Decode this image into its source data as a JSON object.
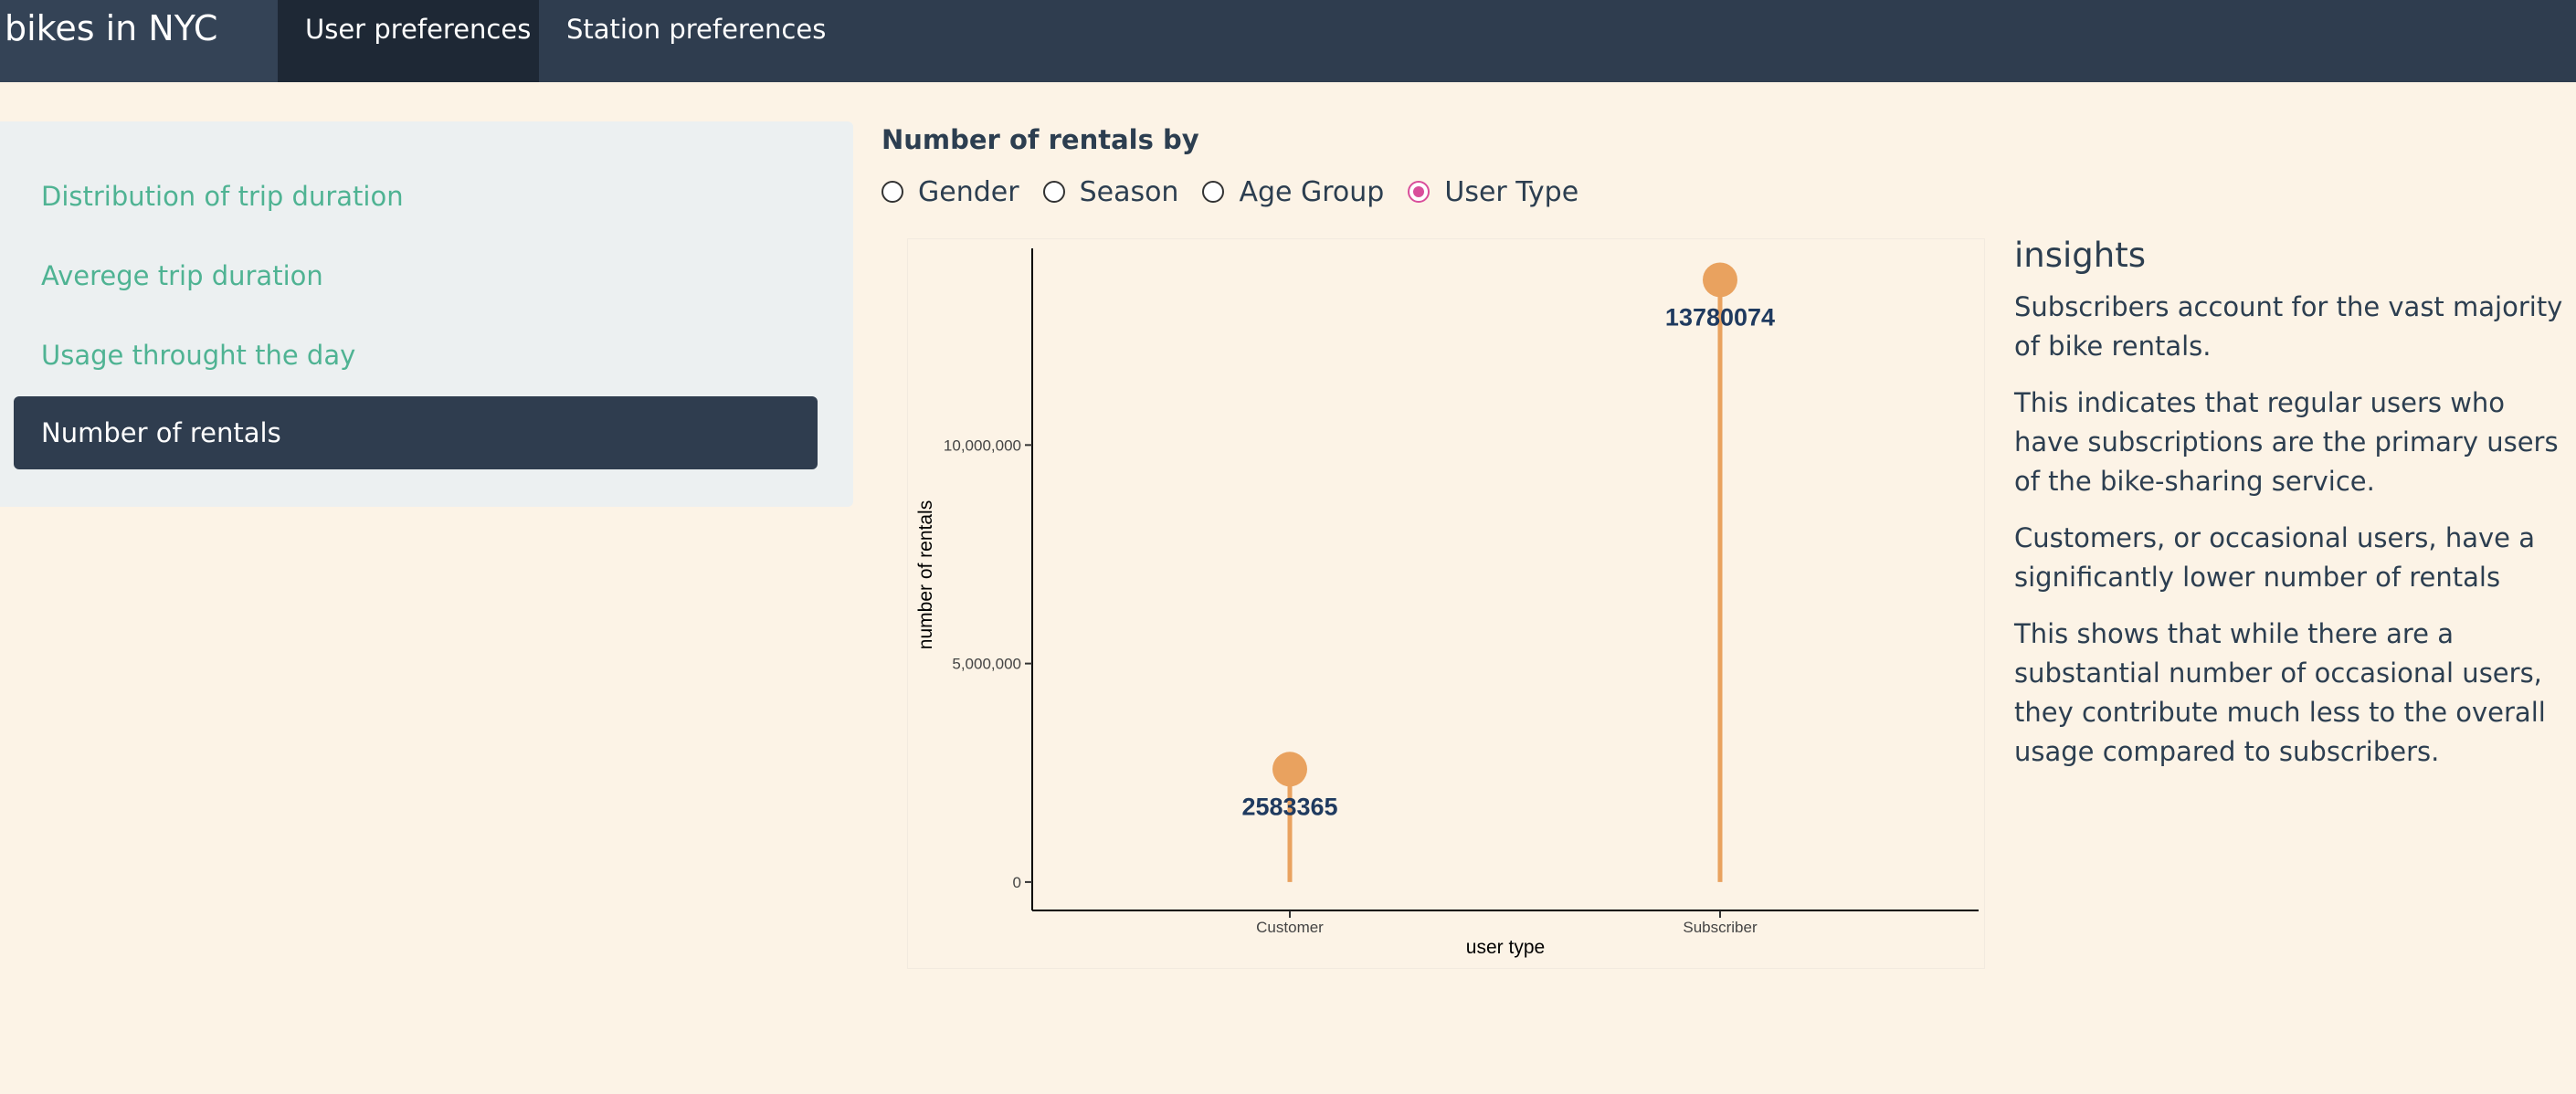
{
  "app": {
    "brand": "bikes in NYC",
    "tabs": [
      {
        "label": "User preferences",
        "active": true
      },
      {
        "label": "Station preferences",
        "active": false
      }
    ]
  },
  "sidebar": {
    "items": [
      {
        "label": "Distribution of trip duration",
        "active": false
      },
      {
        "label": "Averege trip duration",
        "active": false
      },
      {
        "label": "Usage throught the day",
        "active": false
      },
      {
        "label": "Number of rentals",
        "active": true
      }
    ]
  },
  "controls": {
    "title": "Number of rentals by",
    "options": [
      {
        "label": "Gender",
        "selected": false
      },
      {
        "label": "Season",
        "selected": false
      },
      {
        "label": "Age Group",
        "selected": false
      },
      {
        "label": "User Type",
        "selected": true
      }
    ]
  },
  "chart_data": {
    "type": "lollipop",
    "categories": [
      "Customer",
      "Subscriber"
    ],
    "values": [
      2583365,
      13780074
    ],
    "data_labels": [
      "2583365",
      "13780074"
    ],
    "xlabel": "user type",
    "ylabel": "number of rentals",
    "yticks": [
      0,
      5000000,
      10000000
    ],
    "ytick_labels": [
      "0",
      "5,000,000",
      "10,000,000"
    ],
    "ylim": [
      -650000,
      14500000
    ],
    "grid": false,
    "color": "#e9a25f"
  },
  "insights": {
    "title": "insights",
    "paragraphs": [
      "Subscribers account for the vast majority of bike rentals.",
      "This indicates that regular users who have subscriptions are the primary users of the bike-sharing service.",
      "Customers, or occasional users, have a significantly lower number of rentals",
      "This shows that while there are a substantial number of occasional users, they contribute much less to the overall usage compared to subscribers."
    ]
  },
  "colors": {
    "navbar": "#2f3d4f",
    "accent": "#4fb393",
    "background": "#fcf3e6",
    "radio_selected": "#d94e9b"
  }
}
